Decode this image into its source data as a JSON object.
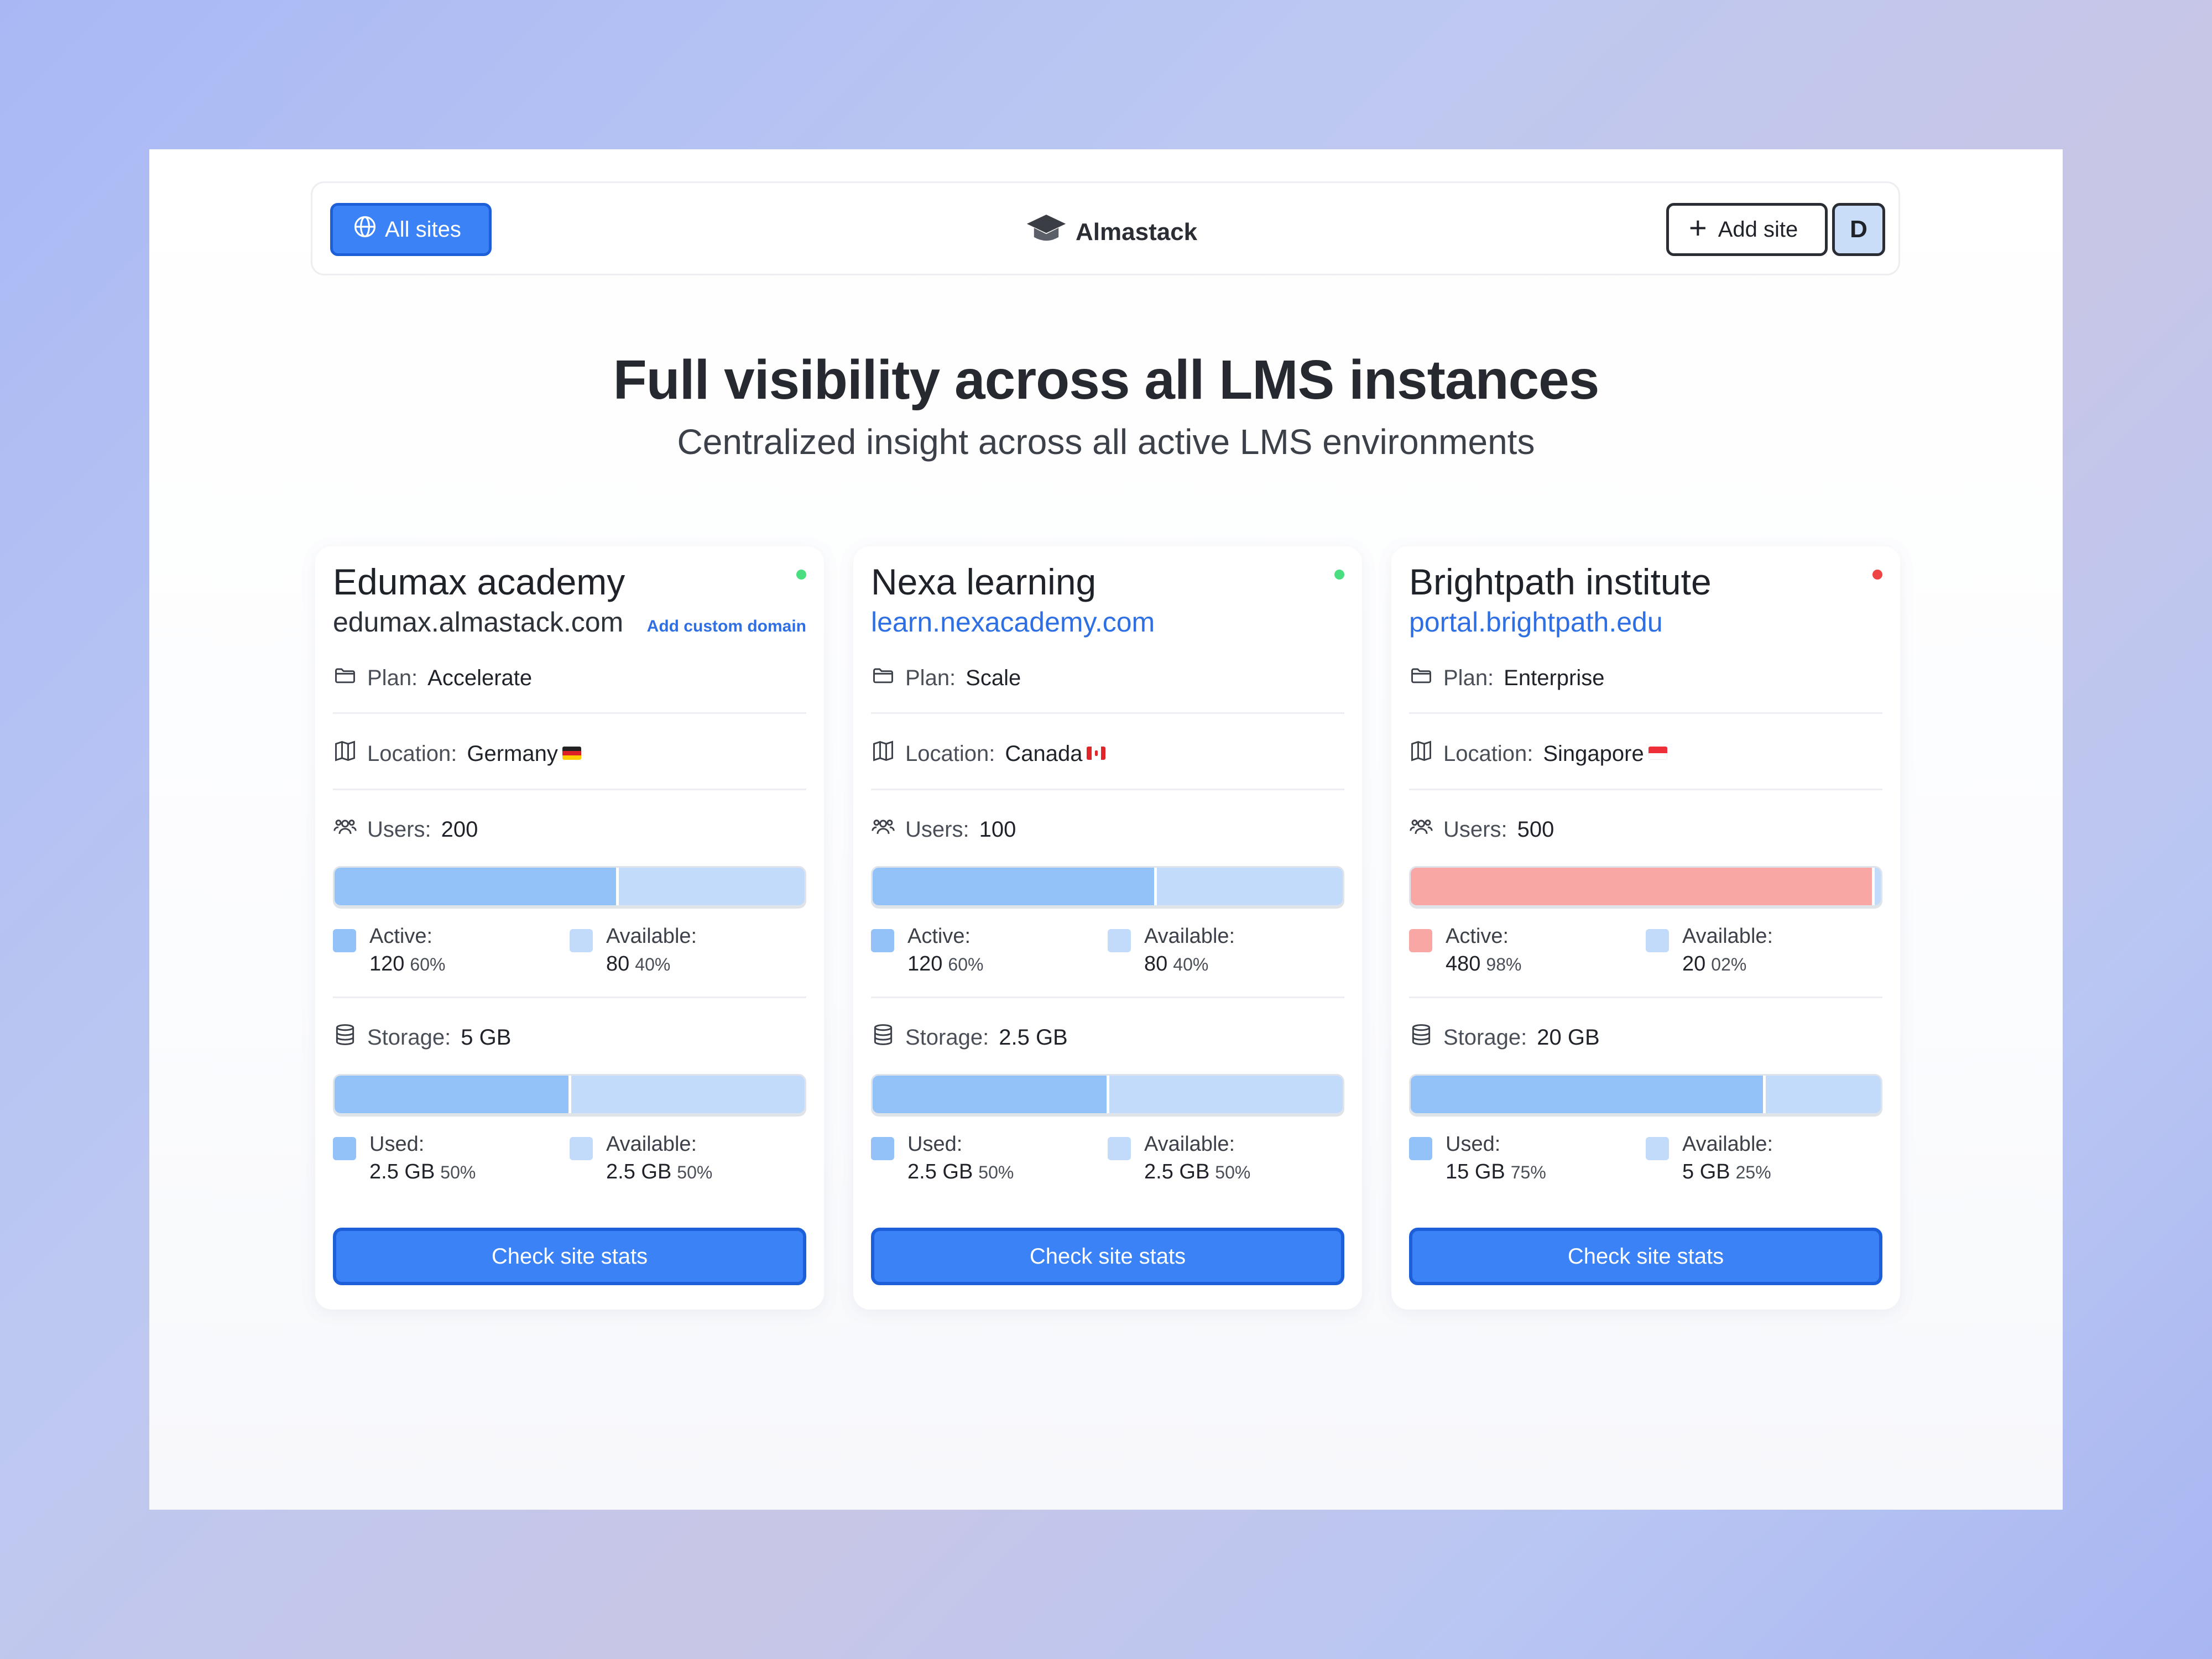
{
  "header": {
    "all_sites_label": "All sites",
    "brand": "Almastack",
    "add_site_label": "Add site",
    "avatar_initial": "D"
  },
  "hero": {
    "title": "Full visibility across all LMS instances",
    "subtitle": "Centralized insight across all active LMS environments"
  },
  "labels": {
    "plan": "Plan:",
    "location": "Location:",
    "users": "Users:",
    "storage": "Storage:",
    "active": "Active:",
    "available": "Available:",
    "used": "Used:",
    "check_stats": "Check site stats"
  },
  "colors": {
    "accent": "#3b82f6",
    "online": "#4ade80",
    "offline": "#ef4444",
    "fill_blue": "#93c2f8",
    "fill_light": "#c3dbfb",
    "fill_red": "#f9a7a5"
  },
  "sites": [
    {
      "name": "Edumax academy",
      "status": "online",
      "domain": "edumax.almastack.com",
      "domain_is_custom": false,
      "add_custom_domain": "Add custom domain",
      "plan": "Accelerate",
      "location": "Germany",
      "flag": "de",
      "users_total": "200",
      "users_active_fraction": 0.6,
      "users_active": "120",
      "users_active_pct": "60%",
      "users_available": "80",
      "users_available_pct": "40%",
      "storage_total": "5 GB",
      "storage_used_fraction": 0.5,
      "storage_used": "2.5 GB",
      "storage_used_pct": "50%",
      "storage_available": "2.5 GB",
      "storage_available_pct": "50%"
    },
    {
      "name": "Nexa learning",
      "status": "online",
      "domain": "learn.nexacademy.com",
      "domain_is_custom": true,
      "plan": "Scale",
      "location": "Canada",
      "flag": "ca",
      "users_total": "100",
      "users_active_fraction": 0.6,
      "users_active": "120",
      "users_active_pct": "60%",
      "users_available": "80",
      "users_available_pct": "40%",
      "storage_total": "2.5 GB",
      "storage_used_fraction": 0.5,
      "storage_used": "2.5 GB",
      "storage_used_pct": "50%",
      "storage_available": "2.5 GB",
      "storage_available_pct": "50%"
    },
    {
      "name": "Brightpath institute",
      "status": "offline",
      "domain": "portal.brightpath.edu",
      "domain_is_custom": true,
      "plan": "Enterprise",
      "location": "Singapore",
      "flag": "sg",
      "users_total": "500",
      "users_active_fraction": 0.98,
      "users_over_limit": true,
      "users_active": "480",
      "users_active_pct": "98%",
      "users_available": "20",
      "users_available_pct": "02%",
      "storage_total": "20 GB",
      "storage_used_fraction": 0.75,
      "storage_used": "15 GB",
      "storage_used_pct": "75%",
      "storage_available": "5 GB",
      "storage_available_pct": "25%"
    }
  ]
}
